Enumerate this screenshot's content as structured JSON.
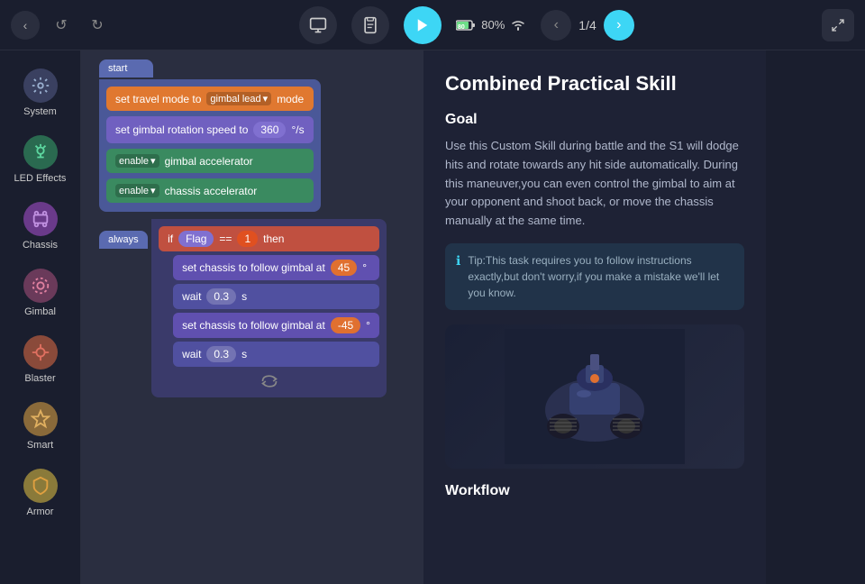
{
  "topbar": {
    "back_label": "‹",
    "undo_label": "↺",
    "redo_label": "↻",
    "monitor_icon": "🖥",
    "clipboard_icon": "📋",
    "play_icon": "▶",
    "battery_pct": "80%",
    "wifi_icon": "wifi",
    "nav_current": "1",
    "nav_total": "4",
    "nav_sep": "/",
    "fullscreen_icon": "⛶"
  },
  "sidebar": {
    "items": [
      {
        "id": "system",
        "label": "System",
        "icon": "⚙️",
        "iconClass": "icon-system"
      },
      {
        "id": "led-effects",
        "label": "LED Effects",
        "icon": "💡",
        "iconClass": "icon-led"
      },
      {
        "id": "chassis",
        "label": "Chassis",
        "icon": "🔮",
        "iconClass": "icon-chassis"
      },
      {
        "id": "gimbal",
        "label": "Gimbal",
        "icon": "🎯",
        "iconClass": "icon-gimbal"
      },
      {
        "id": "blaster",
        "label": "Blaster",
        "icon": "🔴",
        "iconClass": "icon-blaster"
      },
      {
        "id": "smart",
        "label": "Smart",
        "icon": "🟡",
        "iconClass": "icon-smart"
      },
      {
        "id": "armor",
        "label": "Armor",
        "icon": "🟠",
        "iconClass": "icon-armor"
      }
    ]
  },
  "blocks": {
    "start_label": "start",
    "block1_text": "set travel mode to",
    "block1_dropdown": "gimbal lead",
    "block1_suffix": "mode",
    "block2_text": "set gimbal rotation speed to",
    "block2_value": "360",
    "block2_suffix": "°/s",
    "block3_prefix": "enable",
    "block3_text": "gimbal accelerator",
    "block4_prefix": "enable",
    "block4_text": "chassis accelerator",
    "always_label": "always",
    "if_label": "if",
    "flag_label": "Flag",
    "eq_label": "==",
    "val_label": "1",
    "then_label": "then",
    "block5_text": "set chassis to follow gimbal at",
    "block5_val": "45",
    "block5_suffix": "°",
    "wait1_label": "wait",
    "wait1_val": "0.3",
    "wait1_suffix": "s",
    "block6_text": "set chassis to follow gimbal at",
    "block6_val": "-45",
    "block6_suffix": "°",
    "wait2_label": "wait",
    "wait2_val": "0.3",
    "wait2_suffix": "s",
    "loop_icon": "⟳"
  },
  "panel": {
    "title": "Combined Practical Skill",
    "goal_section": "Goal",
    "goal_text": "Use this Custom Skill during battle and the S1 will dodge hits and rotate towards any hit side automatically. During this maneuver,you can even control the gimbal to aim at your opponent and shoot back, or move the chassis manually at the same time.",
    "tip_text": "Tip:This task requires you to follow instructions exactly,but don't worry,if you make a mistake we'll let you know.",
    "workflow_section": "Workflow"
  }
}
